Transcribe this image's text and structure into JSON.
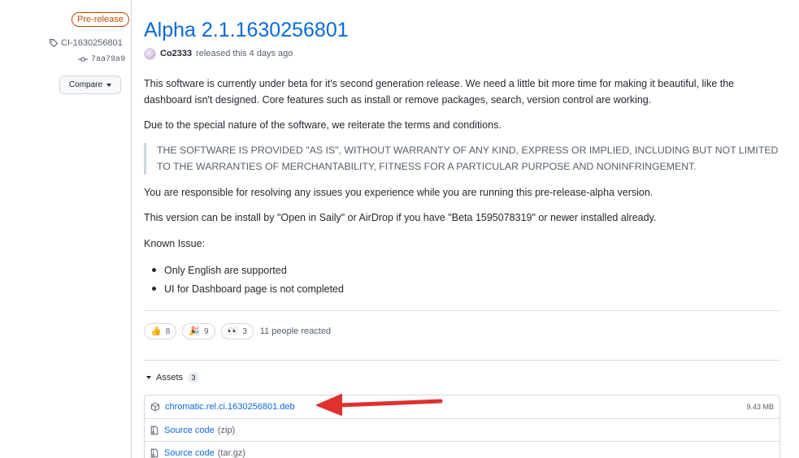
{
  "sidebar": {
    "badge": "Pre-release",
    "tag": "CI-1630256801",
    "commit": "7aa79a9",
    "compare_label": "Compare"
  },
  "release": {
    "title": "Alpha 2.1.1630256801",
    "author": "Co2333",
    "released_text": "released this 4 days ago"
  },
  "body": {
    "p1": "This software is currently under beta for it's second generation release. We need a little bit more time for making it beautiful, like the dashboard isn't designed. Core features such as install or remove packages, search, version control are working.",
    "p2": "Due to the special nature of the software, we reiterate the terms and conditions.",
    "quote": "THE SOFTWARE IS PROVIDED \"AS IS\", WITHOUT WARRANTY OF ANY KIND, EXPRESS OR IMPLIED, INCLUDING BUT NOT LIMITED TO THE WARRANTIES OF MERCHANTABILITY, FITNESS FOR A PARTICULAR PURPOSE AND NONINFRINGEMENT.",
    "p3": "You are responsible for resolving any issues you experience while you are running this pre-release-alpha version.",
    "p4": "This version can be install by \"Open in Saily\" or AirDrop if you have \"Beta 1595078319\" or newer installed already.",
    "known_issue_label": "Known Issue:",
    "issues": [
      "Only English are supported",
      "UI for Dashboard page is not completed"
    ]
  },
  "reactions": {
    "items": [
      {
        "emoji": "👍",
        "icon": "thumbs-up-icon",
        "count": "8"
      },
      {
        "emoji": "🎉",
        "icon": "hooray-icon",
        "count": "9"
      },
      {
        "emoji": "👀",
        "icon": "eyes-icon",
        "count": "3"
      }
    ],
    "summary": "11 people reacted"
  },
  "assets": {
    "label": "Assets",
    "count": "3",
    "items": [
      {
        "name": "chromatic.rel.ci.1630256801.deb",
        "sub": "",
        "size": "9.43 MB",
        "icon": "package-icon"
      },
      {
        "name": "Source code",
        "sub": "(zip)",
        "size": "",
        "icon": "file-zip-icon"
      },
      {
        "name": "Source code",
        "sub": "(tar.gz)",
        "size": "",
        "icon": "file-zip-icon"
      }
    ]
  },
  "colors": {
    "link": "#0969da",
    "prerelease": "#bc4c00",
    "annotation_arrow": "#e0312f"
  }
}
